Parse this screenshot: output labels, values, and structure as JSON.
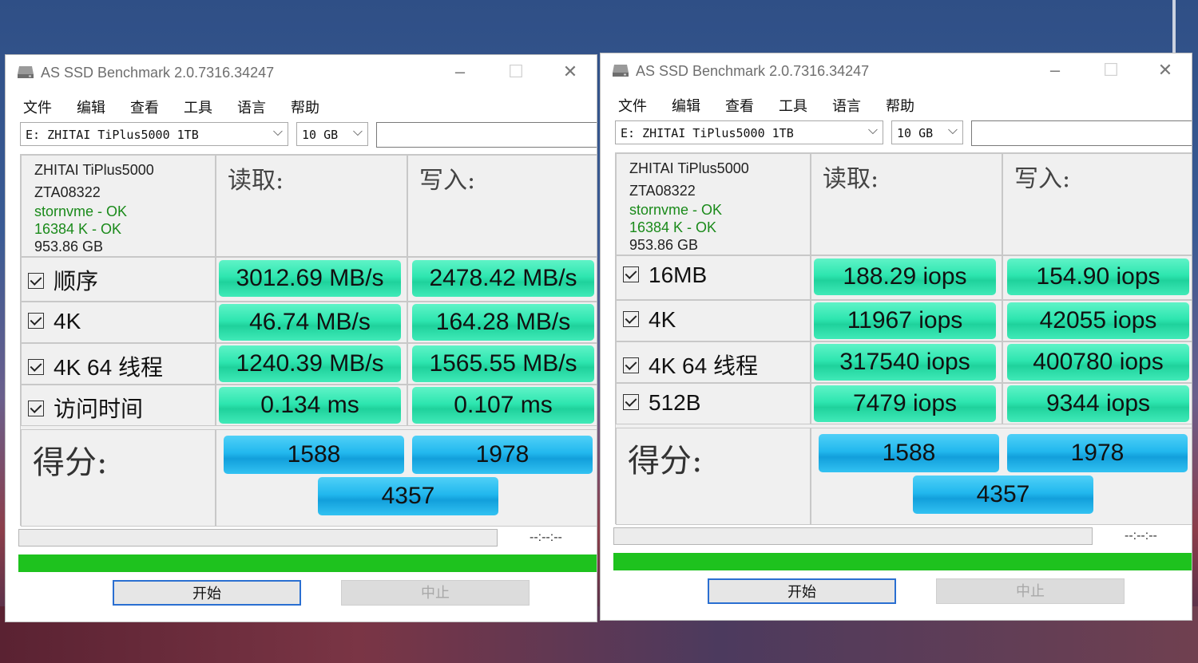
{
  "windows": [
    {
      "title": "AS SSD Benchmark 2.0.7316.34247",
      "menu": [
        "文件",
        "编辑",
        "查看",
        "工具",
        "语言",
        "帮助"
      ],
      "drive_select": "E: ZHITAI TiPlus5000 1TB",
      "size_select": "10 GB",
      "info": {
        "model": "ZHITAI TiPlus5000",
        "firmware": "ZTA08322",
        "driver": "stornvme - OK",
        "alignment": "16384 K - OK",
        "capacity": "953.86 GB"
      },
      "read_header": "读取:",
      "write_header": "写入:",
      "rows": [
        {
          "label": "顺序",
          "read": "3012.69 MB/s",
          "write": "2478.42 MB/s"
        },
        {
          "label": "4K",
          "read": "46.74 MB/s",
          "write": "164.28 MB/s"
        },
        {
          "label": "4K 64 线程",
          "read": "1240.39 MB/s",
          "write": "1565.55 MB/s"
        },
        {
          "label": "访问时间",
          "read": "0.134 ms",
          "write": "0.107 ms"
        }
      ],
      "score_label": "得分:",
      "score_read": "1588",
      "score_write": "1978",
      "score_total": "4357",
      "time": "--:--:--",
      "start_label": "开始",
      "stop_label": "中止"
    },
    {
      "title": "AS SSD Benchmark 2.0.7316.34247",
      "menu": [
        "文件",
        "编辑",
        "查看",
        "工具",
        "语言",
        "帮助"
      ],
      "drive_select": "E: ZHITAI TiPlus5000 1TB",
      "size_select": "10 GB",
      "info": {
        "model": "ZHITAI TiPlus5000",
        "firmware": "ZTA08322",
        "driver": "stornvme - OK",
        "alignment": "16384 K - OK",
        "capacity": "953.86 GB"
      },
      "read_header": "读取:",
      "write_header": "写入:",
      "rows": [
        {
          "label": "16MB",
          "read": "188.29 iops",
          "write": "154.90 iops"
        },
        {
          "label": "4K",
          "read": "11967 iops",
          "write": "42055 iops"
        },
        {
          "label": "4K 64 线程",
          "read": "317540 iops",
          "write": "400780 iops"
        },
        {
          "label": "512B",
          "read": "7479 iops",
          "write": "9344 iops"
        }
      ],
      "score_label": "得分:",
      "score_read": "1588",
      "score_write": "1978",
      "score_total": "4357",
      "time": "--:--:--",
      "start_label": "开始",
      "stop_label": "中止"
    }
  ],
  "colors": {
    "value_box": "#2ee6b0",
    "score_box": "#22b8ee",
    "progress_green": "#1ec21e",
    "ok_text": "#1a8a1a"
  }
}
